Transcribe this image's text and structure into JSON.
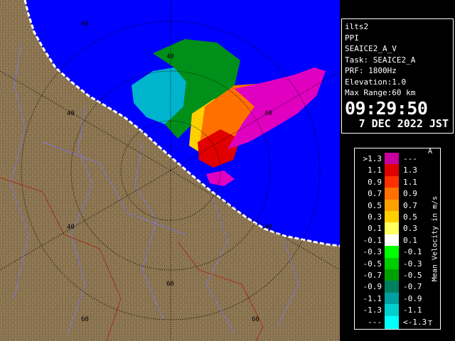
{
  "info": {
    "site": "ilts2",
    "scan_type": "PPI",
    "scan_id": "SEAICE2_A_V",
    "task": "Task: SEAICE2_A",
    "prf": "PRF: 1800Hz",
    "elevation": "Elevation:1.0",
    "max_range": "Max Range:60 km",
    "time": "09:29:50",
    "date": "7 DEC 2022 JST"
  },
  "legend": {
    "title": "Mean Velocity in m/s",
    "marker_top": "A",
    "marker_bottom": "T",
    "rows": [
      {
        "lo": ">1.3",
        "color": "#c800a0",
        "hi": "---"
      },
      {
        "lo": "1.1",
        "color": "#e00000",
        "hi": "1.3"
      },
      {
        "lo": "0.9",
        "color": "#ff3000",
        "hi": "1.1"
      },
      {
        "lo": "0.7",
        "color": "#ff7000",
        "hi": "0.9"
      },
      {
        "lo": "0.5",
        "color": "#ffa000",
        "hi": "0.7"
      },
      {
        "lo": "0.3",
        "color": "#ffd000",
        "hi": "0.5"
      },
      {
        "lo": "0.1",
        "color": "#ffff60",
        "hi": "0.3"
      },
      {
        "lo": "-0.1",
        "color": "#ffffff",
        "hi": "0.1"
      },
      {
        "lo": "-0.3",
        "color": "#00ff00",
        "hi": "-0.1"
      },
      {
        "lo": "-0.5",
        "color": "#00cc00",
        "hi": "-0.3"
      },
      {
        "lo": "-0.7",
        "color": "#00a000",
        "hi": "-0.5"
      },
      {
        "lo": "-0.9",
        "color": "#008060",
        "hi": "-0.7"
      },
      {
        "lo": "-1.1",
        "color": "#00a0a0",
        "hi": "-0.9"
      },
      {
        "lo": "-1.3",
        "color": "#00d0d0",
        "hi": "-1.1"
      },
      {
        "lo": "---",
        "color": "#00ffff",
        "hi": "<-1.3"
      }
    ]
  },
  "map": {
    "range_labels": [
      "60",
      "40",
      "40",
      "40",
      "40",
      "40",
      "60",
      "60",
      "60"
    ],
    "colors": {
      "sea": "#0000ff",
      "land": "#8a7350",
      "echo_pos": "#e000c0",
      "echo_neg": "#00c8c8"
    }
  }
}
